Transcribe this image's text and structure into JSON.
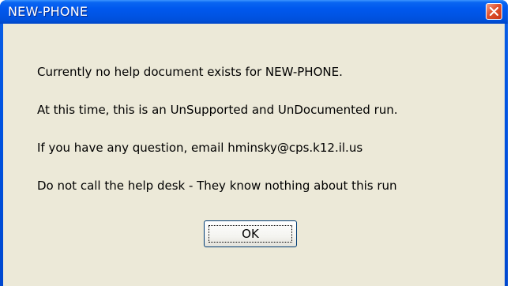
{
  "window": {
    "title": "NEW-PHONE",
    "close_icon": "close-icon"
  },
  "message": {
    "line1": "Currently no help document exists for NEW-PHONE.",
    "line2": "At this time, this is an UnSupported and UnDocumented run.",
    "line3": "If you have any question, email hminsky@cps.k12.il.us",
    "line4": "Do not call the help desk - They know nothing about this run"
  },
  "buttons": {
    "ok_label": "OK"
  },
  "colors": {
    "titlebar": "#0055e6",
    "client": "#ece9d8",
    "close_button": "#e0502c"
  }
}
